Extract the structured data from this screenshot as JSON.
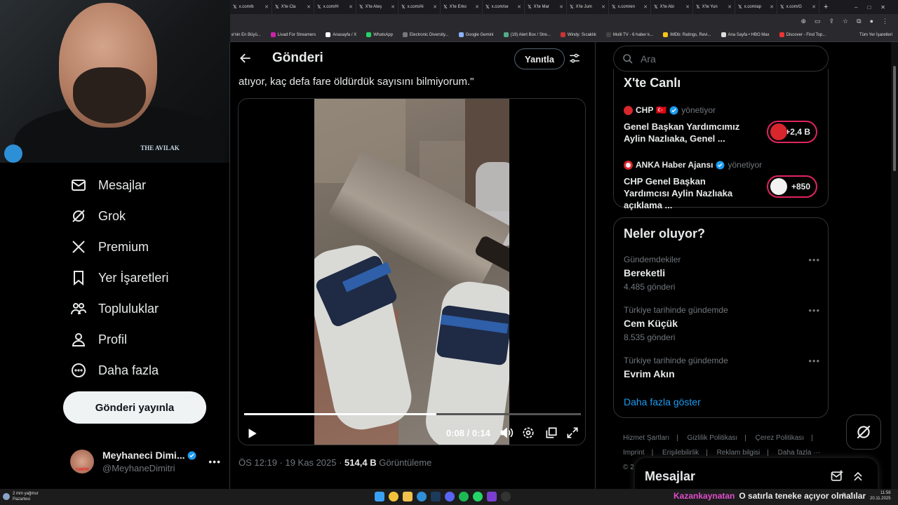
{
  "browser": {
    "tabs": [
      "x.com/b",
      "X'te Cla",
      "x.com/H",
      "X'te Ateş",
      "x.com/Al",
      "X'te Erko",
      "x.com/se",
      "X'te Mar",
      "X'te Jum",
      "x.com/en",
      "X'te Abi",
      "X'te Yun",
      "x.com/ap",
      "x.com/G"
    ],
    "bookmarks": [
      "e'nin En Büyü...",
      "Livad For Streamers",
      "Anasayfa / X",
      "WhatsApp",
      "Electronic Diversity...",
      "Google Gemini",
      "(19) Alert Box / Stre...",
      "Windy: Sıcaklık",
      "Multi TV - 6 haber k...",
      "IMDb: Ratings, Revi...",
      "Ana Sayfa • HBO Max",
      "Discover - Find Top..."
    ],
    "all_bookmarks": "Tüm Yer İşaretleri"
  },
  "webcam": {
    "shirt_text": "THE AVILAK"
  },
  "sidebar": {
    "items": [
      {
        "label": "Mesajlar",
        "icon": "mail-icon"
      },
      {
        "label": "Grok",
        "icon": "grok-icon"
      },
      {
        "label": "Premium",
        "icon": "x-logo-icon"
      },
      {
        "label": "Yer İşaretleri",
        "icon": "bookmark-icon"
      },
      {
        "label": "Topluluklar",
        "icon": "communities-icon"
      },
      {
        "label": "Profil",
        "icon": "profile-icon"
      },
      {
        "label": "Daha fazla",
        "icon": "more-circle-icon"
      }
    ],
    "post_button": "Gönderi yayınla",
    "account": {
      "name": "Meyhaneci Dimi...",
      "handle": "@MeyhaneDimitri",
      "avatar_label": "YUMİTR"
    }
  },
  "post": {
    "header_title": "Gönderi",
    "reply_button": "Yanıtla",
    "text": "atıyor, kaç defa fare öldürdük sayısını bilmiyorum.\"",
    "video": {
      "time": "0:08 / 0:14",
      "progress": 0.5714
    },
    "timestamp": "ÖS 12:19 · 19 Kas 2025 · ",
    "views_count": "514,4 B",
    "views_label": " Görüntüleme"
  },
  "right": {
    "search_placeholder": "Ara",
    "live": {
      "title": "X'te Canlı",
      "items": [
        {
          "source": "CHP",
          "flag": "🇹🇷",
          "status": "yönetiyor",
          "desc": "Genel Başkan Yardımcımız Aylin Nazlıaka, Genel ...",
          "count": "+2,4 B"
        },
        {
          "source": "ANKA Haber Ajansı",
          "status": "yönetiyor",
          "desc": "CHP Genel Başkan Yardımcısı Aylin Nazlıaka açıklama ...",
          "count": "+850"
        }
      ]
    },
    "trends": {
      "title": "Neler oluyor?",
      "items": [
        {
          "context": "Gündemdekiler",
          "topic": "Bereketli",
          "count": "4.485 gönderi"
        },
        {
          "context": "Türkiye tarihinde gündemde",
          "topic": "Cem Küçük",
          "count": "8.535 gönderi"
        },
        {
          "context": "Türkiye tarihinde gündemde",
          "topic": "Evrim Akın",
          "count": ""
        }
      ],
      "show_more": "Daha fazla göster"
    },
    "footer": [
      "Hizmet Şartları",
      "Gizlilik Politikası",
      "Çerez Politikası",
      "Imprint",
      "Erişilebilirlik",
      "Reklam bilgisi",
      "Daha fazla ···",
      "© 2"
    ],
    "messages_dock": "Mesajlar"
  },
  "taskbar": {
    "weather": "2 mm yağmur",
    "weather_sub": "Pazartesi",
    "ticker_user": "Kazankaynatan",
    "ticker_msg": "O satırla teneke açıyor olmalılar",
    "time": "11:58",
    "date": "20.11.2025"
  },
  "colors": {
    "accent": "#1d9bf0",
    "chp_red": "#d8262d",
    "live_border": "#e0245e",
    "ticker_user": "#e04ecb"
  }
}
